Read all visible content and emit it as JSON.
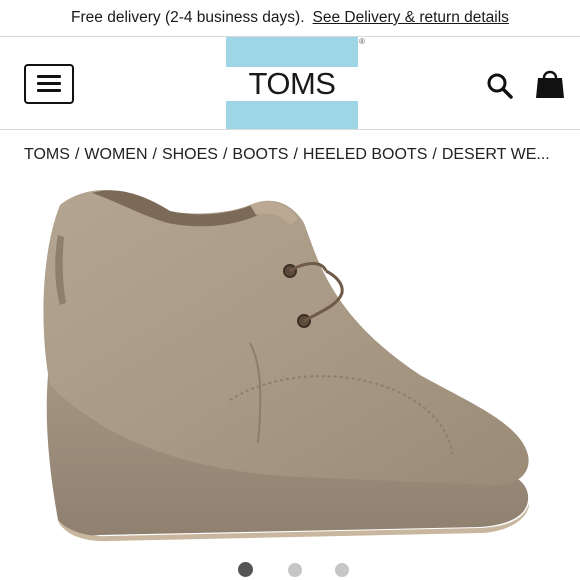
{
  "promo": {
    "text": "Free delivery (2-4 business days).",
    "link": "See Delivery & return details"
  },
  "header": {
    "logo_text": "TOMS",
    "logo_mark": "®",
    "logo_band_color": "#9fd6e5",
    "menu_icon": "hamburger-menu-icon",
    "search_icon": "search-icon",
    "cart_icon": "shopping-bag-icon"
  },
  "breadcrumb": {
    "items": [
      "TOMS",
      "WOMEN",
      "SHOES",
      "BOOTS",
      "HEELED BOOTS",
      "DESERT WE..."
    ],
    "separator": "/"
  },
  "product": {
    "image_icon": "suede-wedge-bootie-image",
    "shoe_color": "#a99a86"
  },
  "carousel": {
    "count": 3,
    "active_index": 0
  }
}
